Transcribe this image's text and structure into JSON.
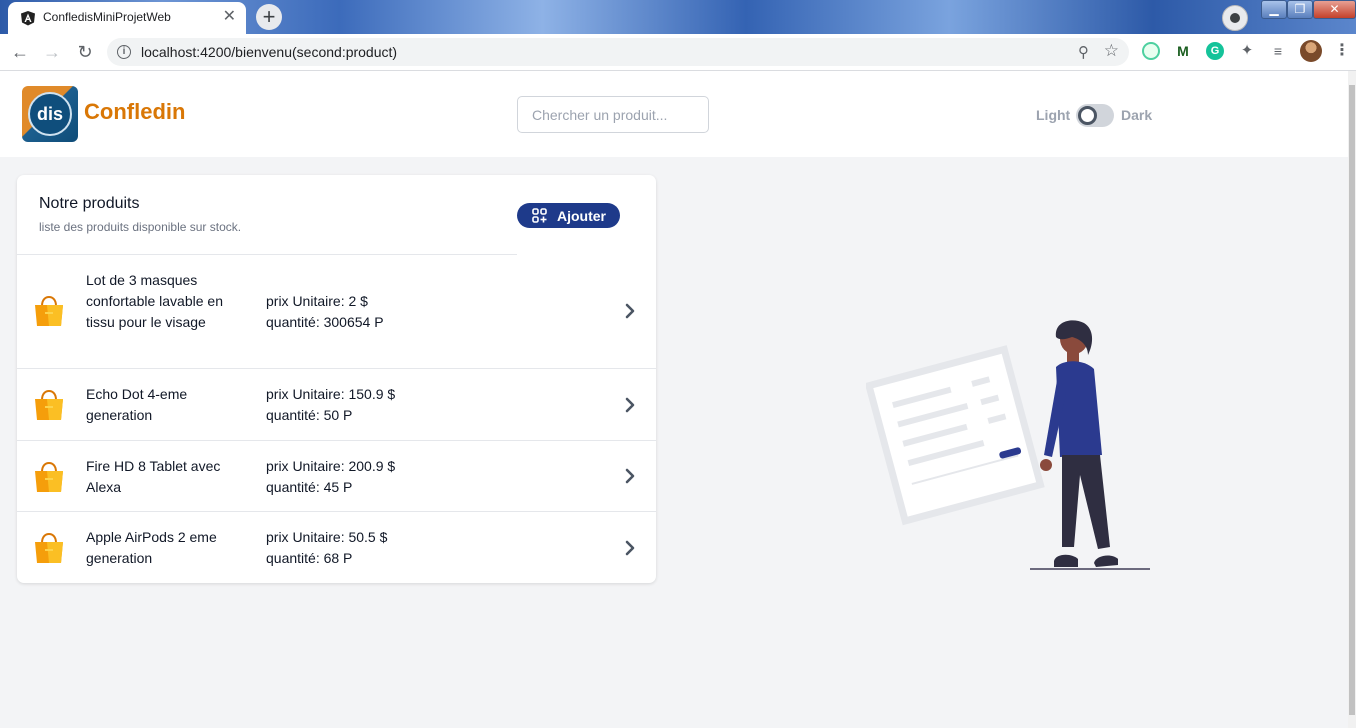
{
  "browser": {
    "tab_title": "ConfledisMiniProjetWeb",
    "tab_close": "✕",
    "newtab": "+",
    "url": "localhost:4200/bienvenu(second:product)",
    "nav": {
      "back": "←",
      "forward": "→",
      "reload": "↻"
    },
    "window": {
      "minimize": "▁",
      "maximize": "❐",
      "close": "✕"
    },
    "ext_labels": {
      "m": "M",
      "g": "G",
      "puzzle": "✦",
      "queue": "≡",
      "more": "⋮"
    }
  },
  "header": {
    "brand": "Confledin",
    "logo_text": "dis",
    "search_placeholder": "Chercher un produit...",
    "theme_light": "Light",
    "theme_dark": "Dark"
  },
  "products_card": {
    "title": "Notre produits",
    "subtitle": "liste des produits disponible sur stock.",
    "add_label": "Ajouter",
    "items": [
      {
        "name": "Lot de 3 masques confortable lavable en tissu pour le visage",
        "price": "prix Unitaire: 2 $",
        "qty": "quantité: 300654 P"
      },
      {
        "name": "Echo Dot 4-eme generation",
        "price": "prix Unitaire: 150.9 $",
        "qty": "quantité: 50 P"
      },
      {
        "name": "Fire HD 8 Tablet avec Alexa",
        "price": "prix Unitaire: 200.9 $",
        "qty": "quantité: 45 P"
      },
      {
        "name": "Apple AirPods 2 eme generation",
        "price": "prix Unitaire: 50.5 $",
        "qty": "quantité: 68 P"
      }
    ]
  },
  "colors": {
    "brand_orange": "#d97706",
    "primary_button": "#1e3a8a",
    "bag_icon": "#f59e0b",
    "background": "#f3f4f6"
  },
  "icons": {
    "product": "shopping-bag-icon",
    "row_action": "chevron-right-icon",
    "add": "grid-plus-icon"
  }
}
